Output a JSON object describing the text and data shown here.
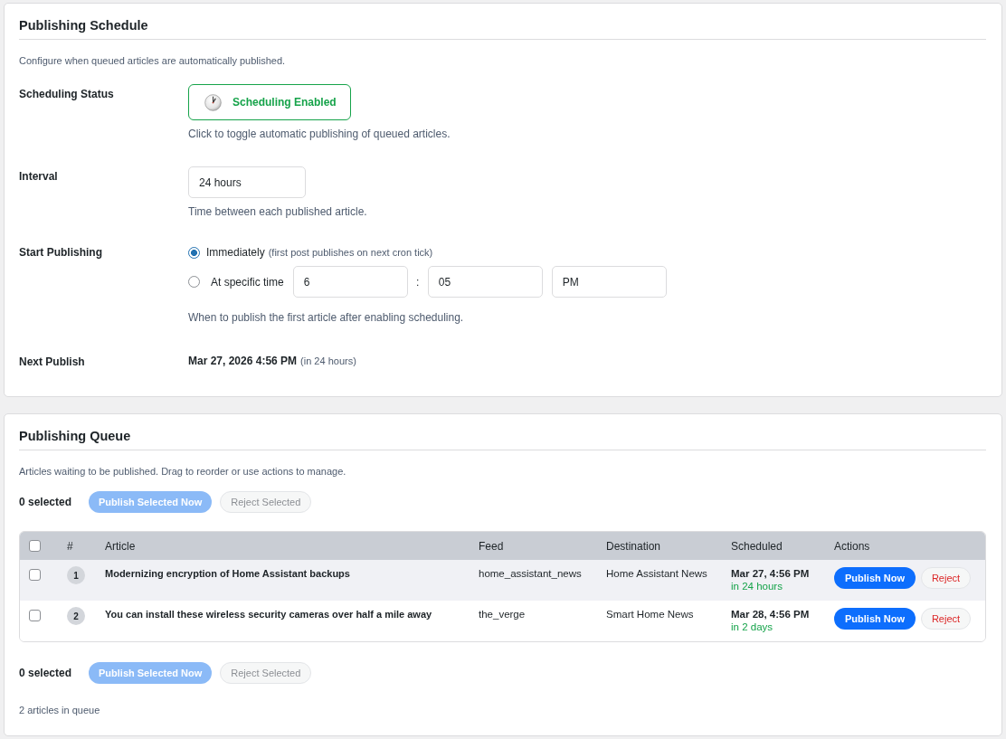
{
  "schedule": {
    "title": "Publishing Schedule",
    "description": "Configure when queued articles are automatically published.",
    "status": {
      "label": "Scheduling Status",
      "button": "Scheduling Enabled",
      "enabled": true,
      "hint": "Click to toggle automatic publishing of queued articles."
    },
    "interval": {
      "label": "Interval",
      "value": "24 hours",
      "hint": "Time between each published article."
    },
    "start": {
      "label": "Start Publishing",
      "options": [
        {
          "kind": "immediate",
          "label": "Immediately",
          "note": "(first post publishes on next cron tick)",
          "selected": true
        },
        {
          "kind": "time",
          "label": "At specific time",
          "selected": false,
          "hour": "6",
          "separator": ":",
          "minute": "05",
          "period": "PM"
        }
      ],
      "hint": "When to publish the first article after enabling scheduling."
    },
    "next": {
      "label": "Next Publish",
      "value": "Mar 27, 2026 4:56 PM",
      "note": "(in 24 hours)"
    }
  },
  "queue": {
    "title": "Publishing Queue",
    "description": "Articles waiting to be published. Drag to reorder or use actions to manage.",
    "bulk_top": {
      "count": "0 selected",
      "publish": {
        "label": "Publish Selected Now",
        "disabled": true
      },
      "reject": {
        "label": "Reject Selected",
        "disabled": true
      }
    },
    "table": {
      "select_all_checked": false,
      "columns": [
        "#",
        "Article",
        "Feed",
        "Destination",
        "Scheduled",
        "Actions"
      ],
      "rows": [
        {
          "checked": false,
          "highlighted": true,
          "number": "1",
          "article": "Modernizing encryption of Home Assistant backups",
          "feed": "home_assistant_news",
          "destination": "Home Assistant News",
          "scheduled": "Mar 27, 4:56 PM",
          "relative": "in 24 hours",
          "publish": "Publish Now",
          "reject": "Reject"
        },
        {
          "checked": false,
          "highlighted": false,
          "number": "2",
          "article": "You can install these wireless security cameras over half a mile away",
          "feed": "the_verge",
          "destination": "Smart Home News",
          "scheduled": "Mar 28, 4:56 PM",
          "relative": "in 2 days",
          "publish": "Publish Now",
          "reject": "Reject"
        }
      ]
    },
    "bulk_bottom": {
      "count": "0 selected",
      "publish": {
        "label": "Publish Selected Now",
        "disabled": true
      },
      "reject": {
        "label": "Reject Selected",
        "disabled": true
      }
    },
    "footer": "2 articles in queue"
  }
}
